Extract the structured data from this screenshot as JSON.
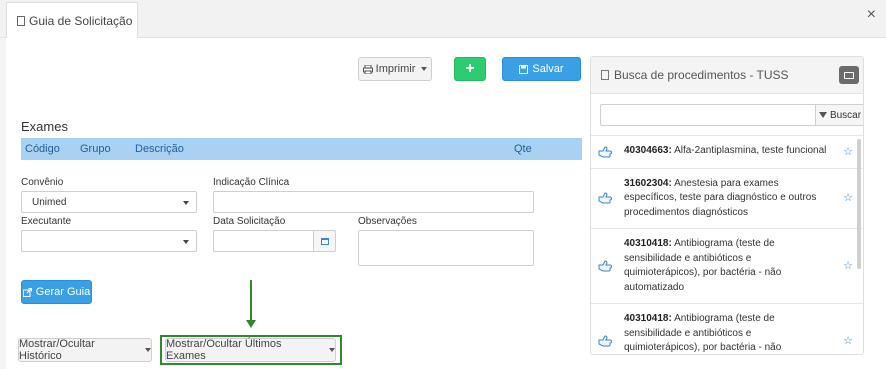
{
  "tab": {
    "title": "Guia de Solicitação"
  },
  "close_glyph": "×",
  "toolbar": {
    "print_label": "Imprimir",
    "add_label": "+",
    "save_label": "Salvar"
  },
  "exams": {
    "title": "Exames",
    "columns": [
      "Código",
      "Grupo",
      "Descrição",
      "Qte"
    ]
  },
  "form": {
    "convenio_label": "Convênio",
    "convenio_value": "Unimed",
    "indicacao_label": "Indicação Clínica",
    "indicacao_value": "",
    "executante_label": "Executante",
    "executante_value": "",
    "data_label": "Data Solicitação",
    "data_value": "",
    "observacoes_label": "Observações",
    "observacoes_value": ""
  },
  "gerar_label": "Gerar Guia",
  "bottom": {
    "historico_label": "Mostrar/Ocultar Histórico",
    "ultimos_label": "Mostrar/Ocultar Últimos Exames"
  },
  "tuss": {
    "title": "Busca de procedimentos - TUSS",
    "search_value": "",
    "search_button": "Buscar",
    "results": [
      {
        "code": "40304663:",
        "desc": "Alfa-2antiplasmina, teste funcional"
      },
      {
        "code": "31602304:",
        "desc": "Anestesia para exames específicos, teste para diagnóstico e outros procedimentos diagnósticos"
      },
      {
        "code": "40310418:",
        "desc": "Antibiograma (teste de sensibilidade e antibióticos e quimioterápicos), por bactéria - não automatizado"
      },
      {
        "code": "40310418:",
        "desc": "Antibiograma (teste de sensibilidade e antibióticos e quimioterápicos), por bactéria - não automatizado"
      }
    ]
  },
  "colors": {
    "accent_blue": "#3aa0e6",
    "green": "#2ecc71",
    "table_header": "#a9d1f1",
    "highlight": "#2d8a2d"
  },
  "icons": {
    "tab": "document-icon",
    "print": "printer-icon",
    "save": "save-icon",
    "gerar": "external-link-icon",
    "calendar": "calendar-icon",
    "folder": "folder-icon",
    "filter": "filter-icon",
    "hand": "hand-point-icon",
    "star": "star-icon"
  }
}
